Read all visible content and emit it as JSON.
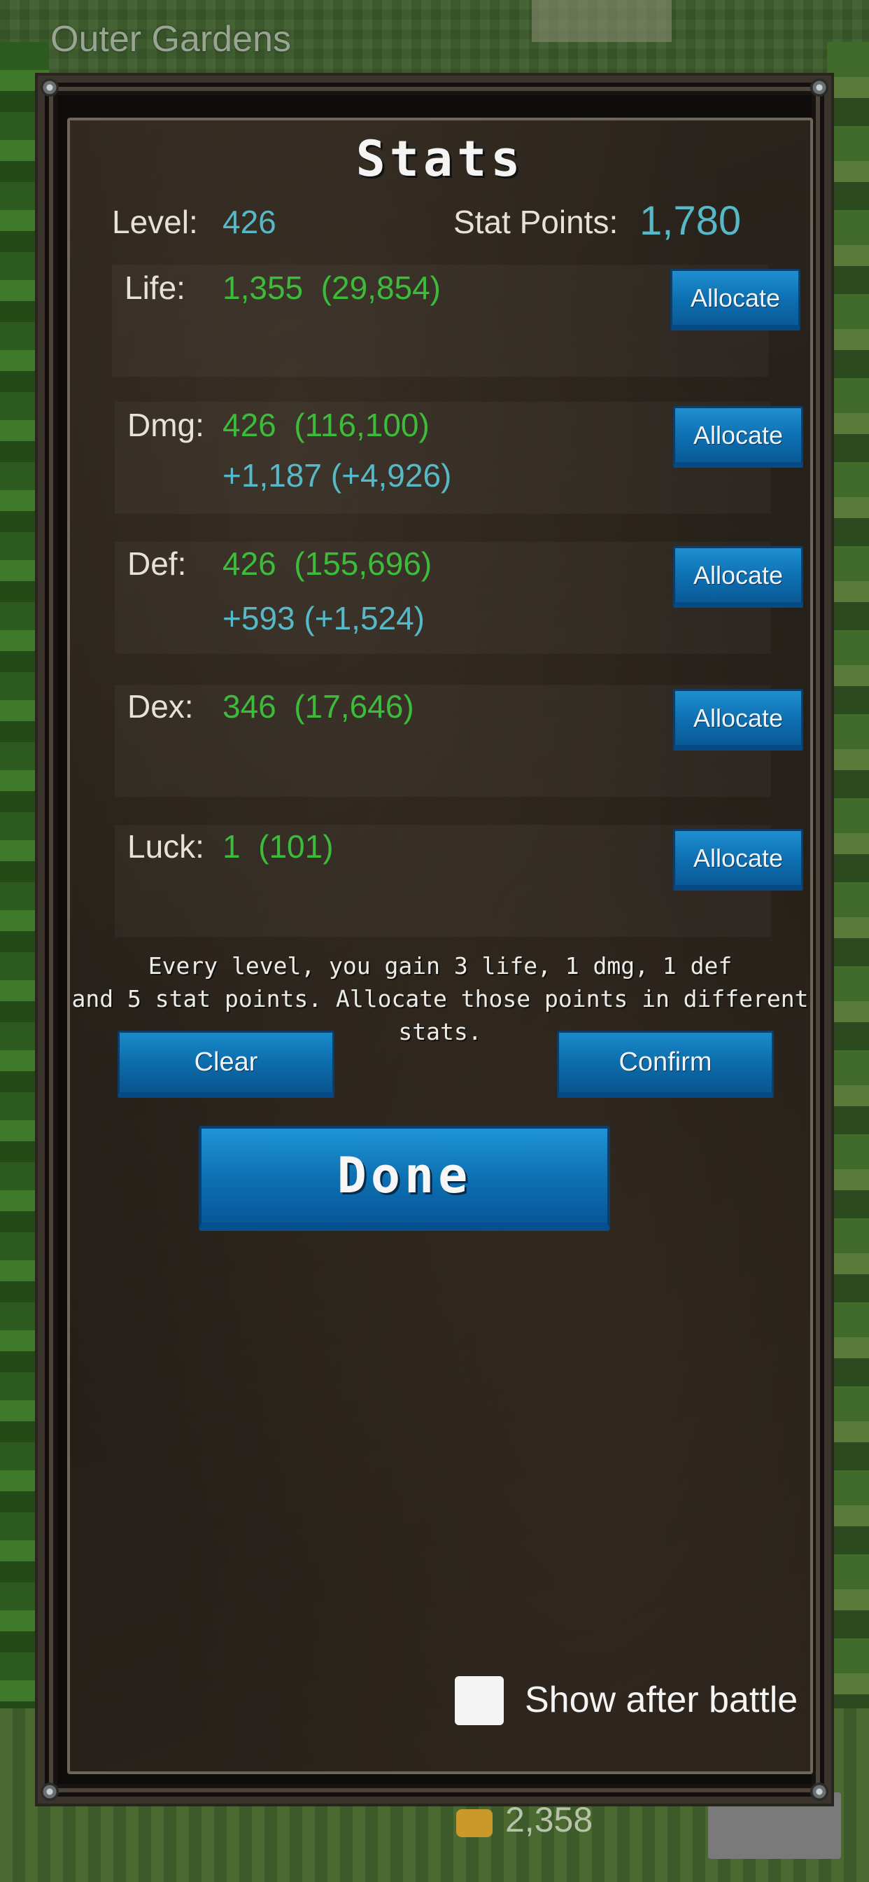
{
  "area_title": "Outer Gardens",
  "bottom_counter": "2,358",
  "panel": {
    "title": "Stats",
    "level_label": "Level:",
    "level_value": "426",
    "stat_points_label": "Stat Points:",
    "stat_points_value": "1,780",
    "stats": [
      {
        "label": "Life:",
        "value": "1,355  (29,854)",
        "bonus": "",
        "button": "Allocate"
      },
      {
        "label": "Dmg:",
        "value": "426  (116,100)",
        "bonus": "+1,187 (+4,926)",
        "button": "Allocate"
      },
      {
        "label": "Def:",
        "value": "426  (155,696)",
        "bonus": "+593 (+1,524)",
        "button": "Allocate"
      },
      {
        "label": "Dex:",
        "value": "346  (17,646)",
        "bonus": "",
        "button": "Allocate"
      },
      {
        "label": "Luck:",
        "value": "1  (101)",
        "bonus": "",
        "button": "Allocate"
      }
    ],
    "info_line1": "Every level, you gain 3 life, 1 dmg, 1 def",
    "info_line2": "and 5 stat points. Allocate those points in different stats.",
    "clear_label": "Clear",
    "confirm_label": "Confirm",
    "done_label": "Done",
    "show_after_battle_label": "Show after battle",
    "show_after_battle_checked": false
  },
  "colors": {
    "value_green": "#3dbb3b",
    "value_blue": "#57b8c8",
    "button_blue": "#0d6eb0"
  }
}
